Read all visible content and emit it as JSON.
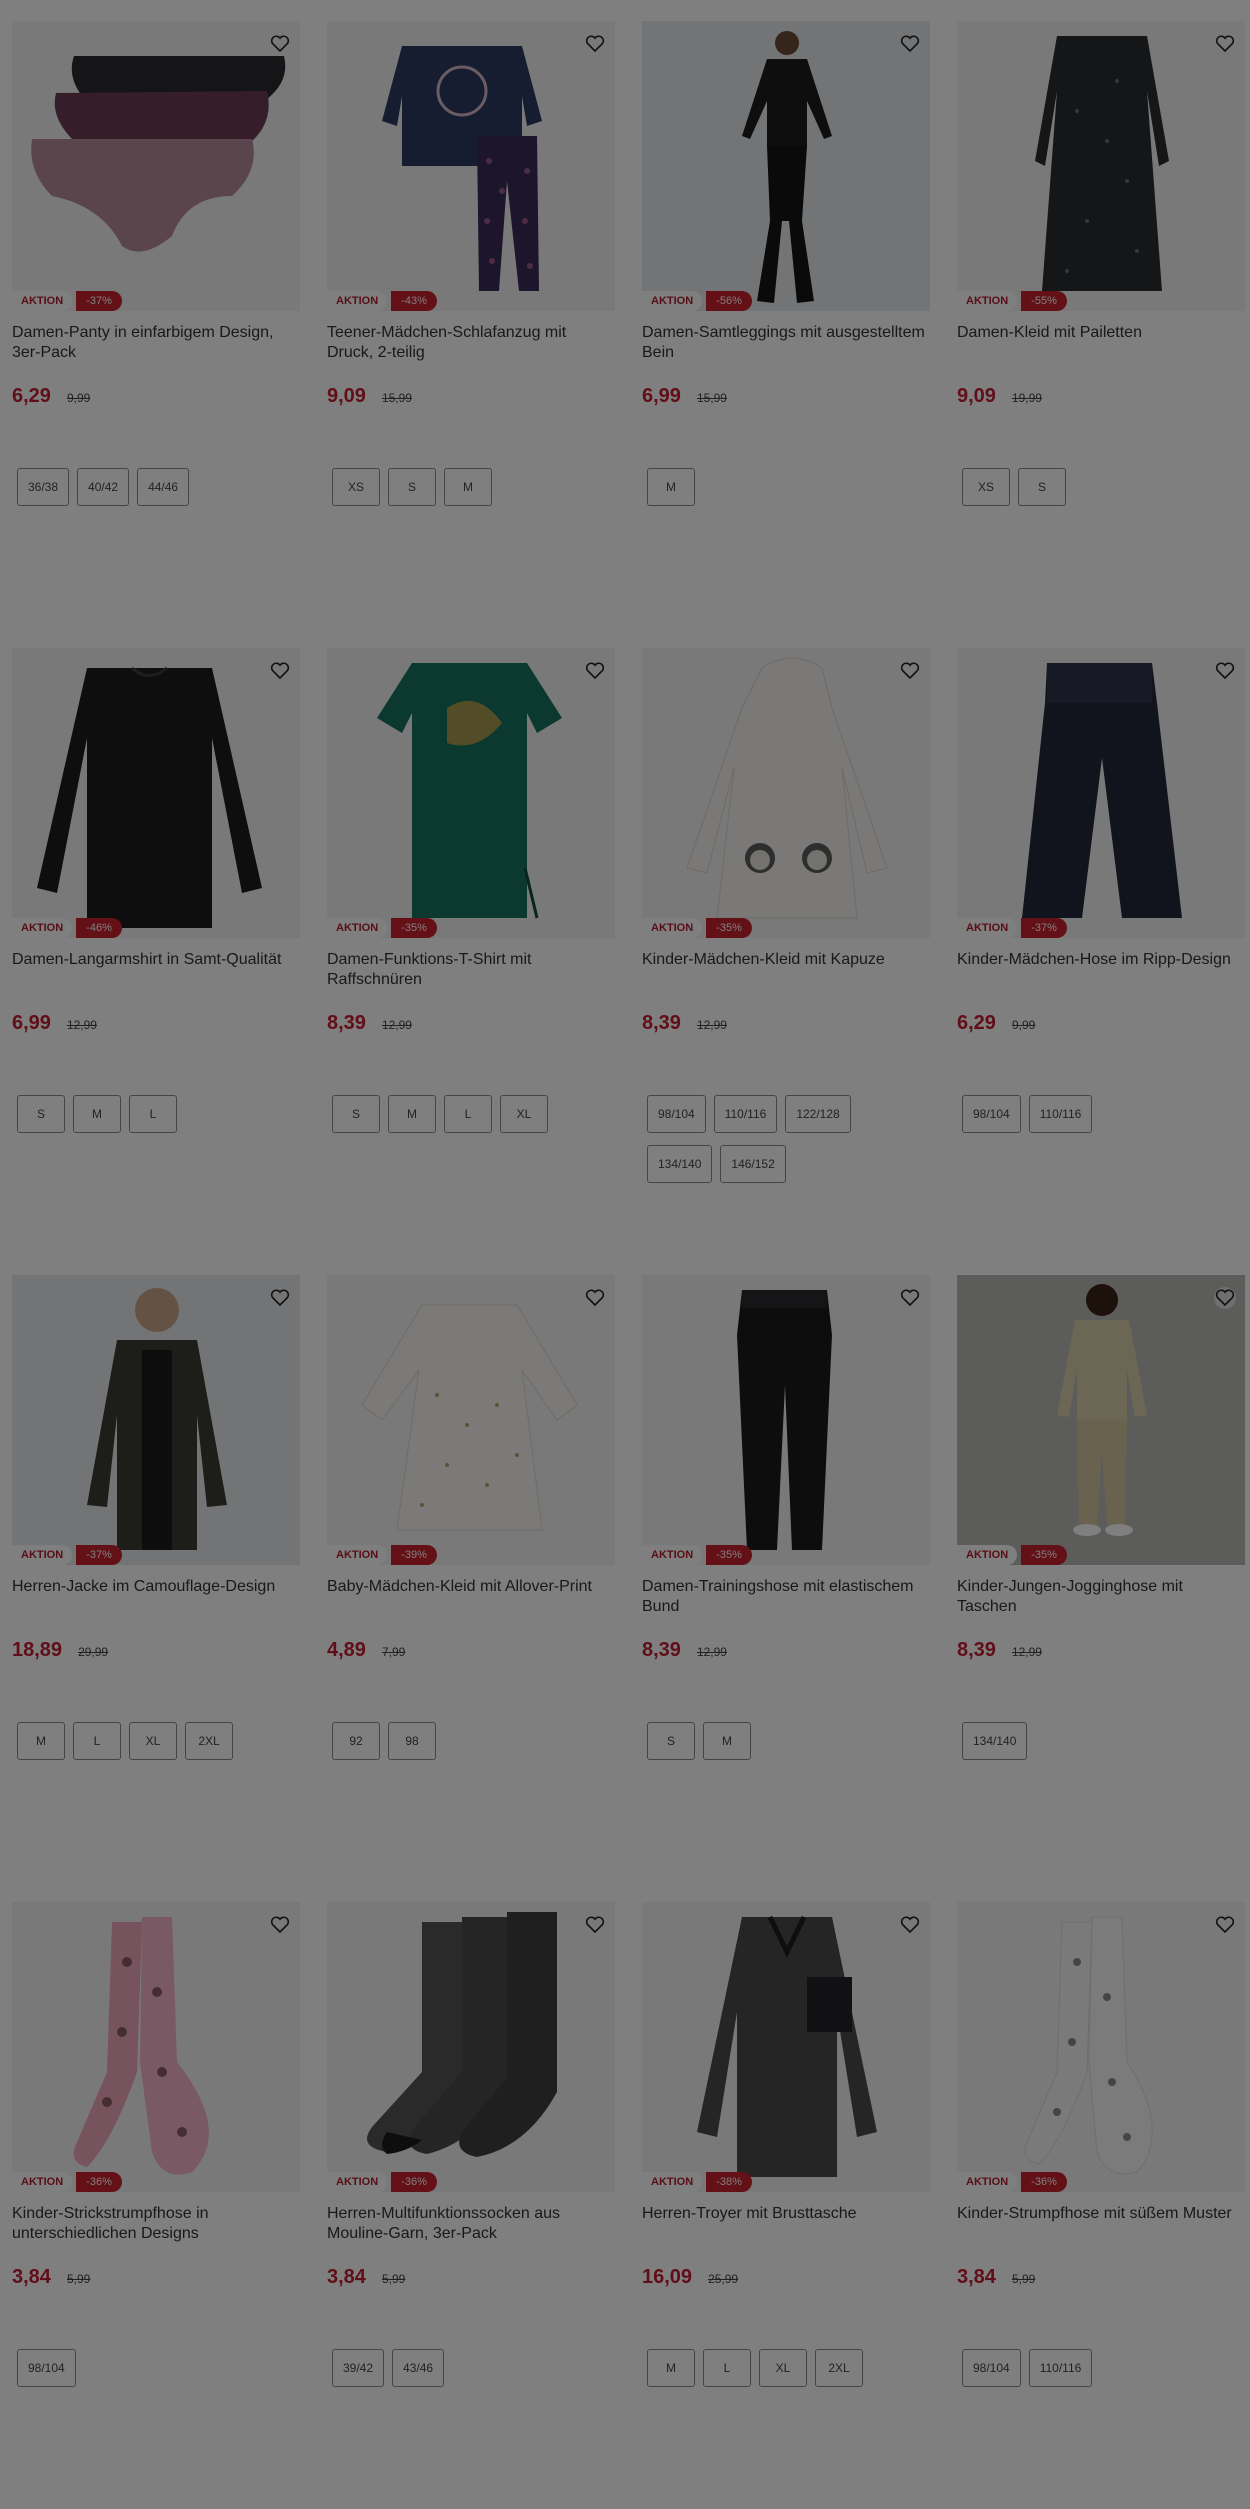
{
  "colors": {
    "sale_red": "#c41d32",
    "badge_red": "#c8202f",
    "overlay": "rgba(0,0,0,0.5)"
  },
  "products": [
    {
      "name": "Damen-Panty in einfarbigem Design, 3er-Pack",
      "badge": "AKTION",
      "discount": "-37%",
      "price": "6,29",
      "old_price": "9,99",
      "sizes": [
        "36/38",
        "40/42",
        "44/46"
      ],
      "image": "panty-pack-image"
    },
    {
      "name": "Teener-Mädchen-Schlafanzug mit Druck, 2-teilig",
      "badge": "AKTION",
      "discount": "-43%",
      "price": "9,09",
      "old_price": "15,99",
      "sizes": [
        "XS",
        "S",
        "M"
      ],
      "image": "pajama-set-image"
    },
    {
      "name": "Damen-Samtleggings mit ausgestelltem Bein",
      "badge": "AKTION",
      "discount": "-56%",
      "price": "6,99",
      "old_price": "15,99",
      "sizes": [
        "M"
      ],
      "image": "model-velvet-leggings-image"
    },
    {
      "name": "Damen-Kleid mit Pailetten",
      "badge": "AKTION",
      "discount": "-55%",
      "price": "9,09",
      "old_price": "19,99",
      "sizes": [
        "XS",
        "S"
      ],
      "image": "sequin-dress-image"
    },
    {
      "name": "Damen-Langarmshirt in Samt-Qualität",
      "badge": "AKTION",
      "discount": "-46%",
      "price": "6,99",
      "old_price": "12,99",
      "sizes": [
        "S",
        "M",
        "L"
      ],
      "image": "velvet-longsleeve-image"
    },
    {
      "name": "Damen-Funktions-T-Shirt mit Raffschnüren",
      "badge": "AKTION",
      "discount": "-35%",
      "price": "8,39",
      "old_price": "12,99",
      "sizes": [
        "S",
        "M",
        "L",
        "XL"
      ],
      "image": "green-tshirt-image"
    },
    {
      "name": "Kinder-Mädchen-Kleid mit Kapuze",
      "badge": "AKTION",
      "discount": "-35%",
      "price": "8,39",
      "old_price": "12,99",
      "sizes": [
        "98/104",
        "110/116",
        "122/128",
        "134/140",
        "146/152"
      ],
      "image": "hooded-dress-image"
    },
    {
      "name": "Kinder-Mädchen-Hose im Ripp-Design",
      "badge": "AKTION",
      "discount": "-37%",
      "price": "6,29",
      "old_price": "9,99",
      "sizes": [
        "98/104",
        "110/116"
      ],
      "image": "rib-trousers-image"
    },
    {
      "name": "Herren-Jacke im Camouflage-Design",
      "badge": "AKTION",
      "discount": "-37%",
      "price": "18,89",
      "old_price": "29,99",
      "sizes": [
        "M",
        "L",
        "XL",
        "2XL"
      ],
      "image": "model-camo-jacket-image"
    },
    {
      "name": "Baby-Mädchen-Kleid mit Allover-Print",
      "badge": "AKTION",
      "discount": "-39%",
      "price": "4,89",
      "old_price": "7,99",
      "sizes": [
        "92",
        "98"
      ],
      "image": "baby-dress-image"
    },
    {
      "name": "Damen-Trainingshose mit elastischem Bund",
      "badge": "AKTION",
      "discount": "-35%",
      "price": "8,39",
      "old_price": "12,99",
      "sizes": [
        "S",
        "M"
      ],
      "image": "training-pants-image"
    },
    {
      "name": "Kinder-Jungen-Jogginghose mit Taschen",
      "badge": "AKTION",
      "discount": "-35%",
      "price": "8,39",
      "old_price": "12,99",
      "sizes": [
        "134/140"
      ],
      "image": "model-boy-joggers-image"
    },
    {
      "name": "Kinder-Strickstrumpfhose in unterschiedlichen Designs",
      "badge": "AKTION",
      "discount": "-36%",
      "price": "3,84",
      "old_price": "5,99",
      "sizes": [
        "98/104"
      ],
      "image": "pink-tights-image"
    },
    {
      "name": "Herren-Multifunktionssocken aus Mouline-Garn, 3er-Pack",
      "badge": "AKTION",
      "discount": "-36%",
      "price": "3,84",
      "old_price": "5,99",
      "sizes": [
        "39/42",
        "43/46"
      ],
      "image": "socks-pack-image"
    },
    {
      "name": "Herren-Troyer mit Brusttasche",
      "badge": "AKTION",
      "discount": "-38%",
      "price": "16,09",
      "old_price": "25,99",
      "sizes": [
        "M",
        "L",
        "XL",
        "2XL"
      ],
      "image": "troyer-sweater-image"
    },
    {
      "name": "Kinder-Strumpfhose mit süßem Muster",
      "badge": "AKTION",
      "discount": "-36%",
      "price": "3,84",
      "old_price": "5,99",
      "sizes": [
        "98/104",
        "110/116"
      ],
      "image": "patterned-tights-image"
    }
  ]
}
